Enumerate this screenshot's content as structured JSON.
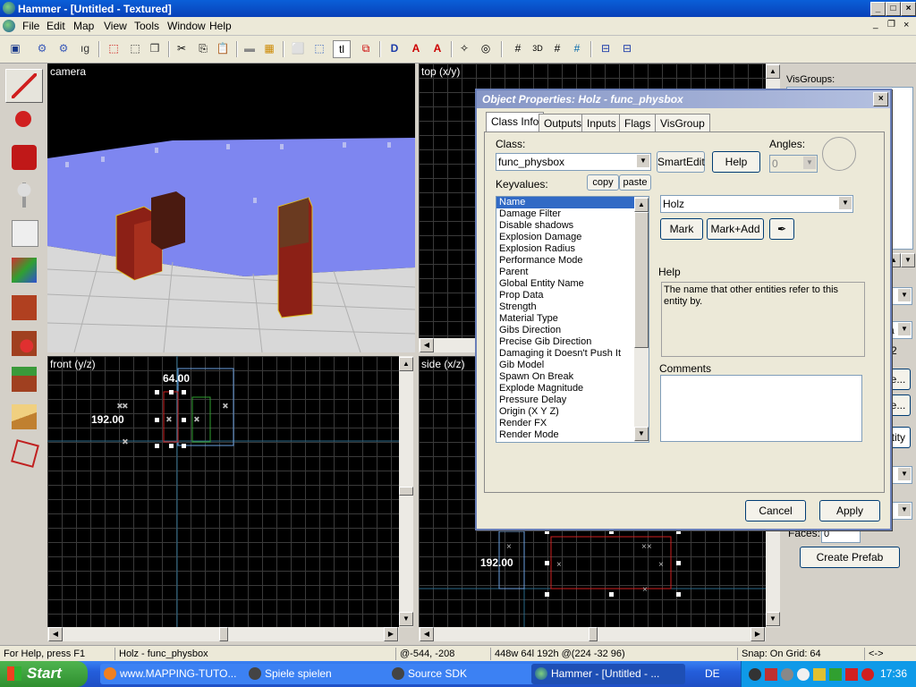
{
  "window": {
    "title": "Hammer - [Untitled - Textured]"
  },
  "menu": [
    "File",
    "Edit",
    "Map",
    "View",
    "Tools",
    "Window",
    "Help"
  ],
  "viewports": {
    "camera_label": "camera",
    "top_label": "top (x/y)",
    "front_label": "front (y/z)",
    "side_label": "side (x/z)",
    "front_width_label": "64.00",
    "front_height_label": "192.00",
    "side_height_label": "192.00"
  },
  "right_panel": {
    "visgroups_label": "VisGroups:",
    "number_2": "2",
    "faces_label": "Faces:",
    "faces_value": "0",
    "create_prefab": "Create Prefab",
    "partial_se": "se...",
    "partial_ce": "ce...",
    "partial_entity": "ntity",
    "partial_za": "za"
  },
  "dialog": {
    "title": "Object Properties: Holz - func_physbox",
    "tabs": [
      "Class Info",
      "Outputs",
      "Inputs",
      "Flags",
      "VisGroup"
    ],
    "class_label": "Class:",
    "class_value": "func_physbox",
    "smartedit": "SmartEdit",
    "help_button": "Help",
    "angles_label": "Angles:",
    "angles_value": "0",
    "keyvalues_label": "Keyvalues:",
    "copy": "copy",
    "paste": "paste",
    "keyvalues": [
      "Name",
      "Damage Filter",
      "Disable shadows",
      "Explosion Damage",
      "Explosion Radius",
      "Performance Mode",
      "Parent",
      "Global Entity Name",
      "Prop Data",
      "Strength",
      "Material Type",
      "Gibs Direction",
      "Precise Gib Direction",
      "Damaging it Doesn't Push It",
      "Gib Model",
      "Spawn On Break",
      "Explode Magnitude",
      "Pressure Delay",
      "Origin (X Y Z)",
      "Render FX",
      "Render Mode"
    ],
    "value": "Holz",
    "mark": "Mark",
    "mark_add": "Mark+Add",
    "help_label": "Help",
    "help_text": "The name that other entities refer to this entity by.",
    "comments_label": "Comments",
    "cancel": "Cancel",
    "apply": "Apply"
  },
  "status": {
    "help": "For Help, press F1",
    "selection": "Holz - func_physbox",
    "coords": "@-544, -208",
    "size": "448w 64l 192h @(224 -32 96)",
    "snap": "Snap: On Grid: 64",
    "arrows": "<->"
  },
  "taskbar": {
    "start": "Start",
    "tasks": [
      "www.MAPPING-TUTO...",
      "Spiele spielen",
      "Source SDK",
      "Hammer - [Untitled - ..."
    ],
    "lang": "DE",
    "clock": "17:36"
  }
}
